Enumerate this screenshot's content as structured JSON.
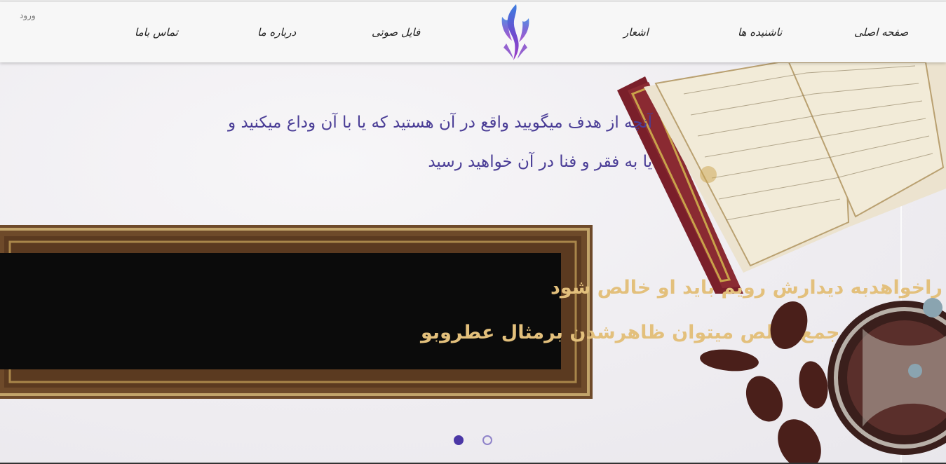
{
  "header": {
    "login_label": "ورود",
    "nav": {
      "home": "صفحه اصلی",
      "unheard": "ناشنیده ها",
      "poems": "اشعار",
      "audio": "فایل صوتی",
      "about": "درباره ما",
      "contact": "تماس باما"
    }
  },
  "hero": {
    "quote_line1": "آنچه از هدف میگویید واقع در آن هستید که یا با آن وداع میکنید و",
    "quote_line2": "یا به فقر و فنا در آن خواهید رسید",
    "frame_line1": "هرکه راخواهدبه دیدارش رویم باید او خالص شود",
    "frame_line2": "درمیان جمع خالص میتوان ظاهرشدن برمثال عطروبو",
    "slides": {
      "total": 2,
      "active": 1
    }
  },
  "colors": {
    "accent": "#4b37a6",
    "quote_text": "#4a3d96",
    "frame_text": "#e3c07c",
    "nav_background": "#f7f7f7"
  },
  "icons": {
    "logo": "phoenix-logo"
  }
}
